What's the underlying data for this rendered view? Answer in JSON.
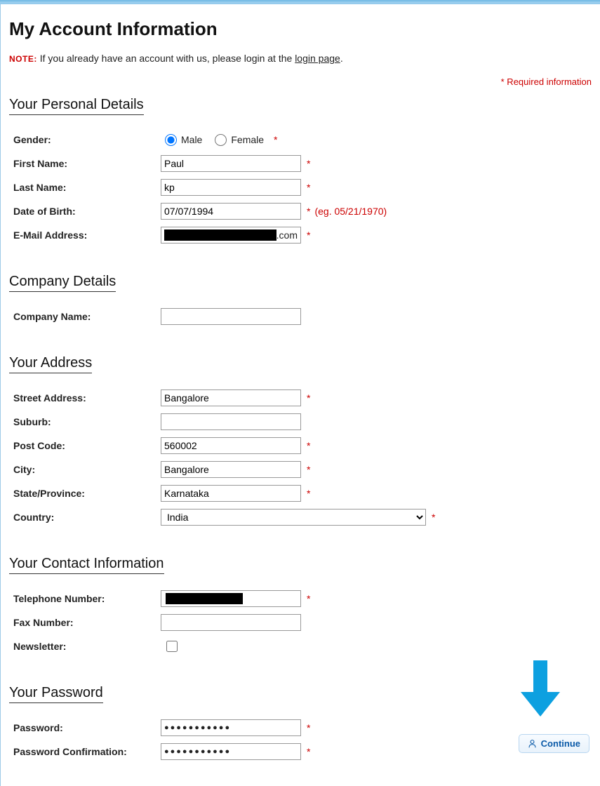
{
  "page_title": "My Account Information",
  "note_label": "NOTE:",
  "note_text_prefix": "If you already have an account with us, please login at the ",
  "note_link": "login page",
  "note_text_suffix": ".",
  "required_text": "* Required information",
  "sections": {
    "personal": "Your Personal Details",
    "company": "Company Details",
    "address": "Your Address",
    "contact": "Your Contact Information",
    "password": "Your Password"
  },
  "labels": {
    "gender": "Gender:",
    "male": "Male",
    "female": "Female",
    "first_name": "First Name:",
    "last_name": "Last Name:",
    "dob": "Date of Birth:",
    "dob_hint": "(eg. 05/21/1970)",
    "email": "E-Mail Address:",
    "company": "Company Name:",
    "street": "Street Address:",
    "suburb": "Suburb:",
    "postcode": "Post Code:",
    "city": "City:",
    "state": "State/Province:",
    "country": "Country:",
    "telephone": "Telephone Number:",
    "fax": "Fax Number:",
    "newsletter": "Newsletter:",
    "password": "Password:",
    "password_confirm": "Password Confirmation:"
  },
  "values": {
    "gender": "male",
    "first_name": "Paul",
    "last_name": "kp",
    "dob": "07/07/1994",
    "email_suffix": ".com",
    "company": "",
    "street": "Bangalore",
    "suburb": "",
    "postcode": "560002",
    "city": "Bangalore",
    "state": "Karnataka",
    "country": "India",
    "fax": "",
    "newsletter": false,
    "password_mask": "●●●●●●●●●●●",
    "password_confirm_mask": "●●●●●●●●●●●"
  },
  "star": "*",
  "continue_label": "Continue",
  "annotation_arrow_color": "#0da0e0"
}
